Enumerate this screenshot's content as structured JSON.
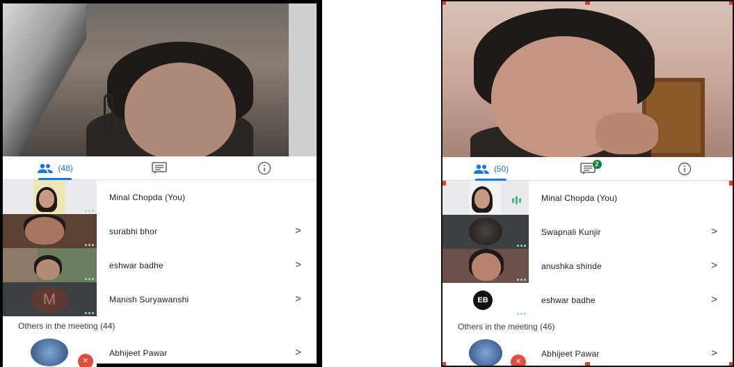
{
  "left": {
    "tabs": {
      "people_count": "(48)"
    },
    "participants": [
      {
        "name": "Minal Chopda (You)"
      },
      {
        "name": "surabhi bhor"
      },
      {
        "name": "eshwar badhe"
      },
      {
        "name": "Manish Suryawanshi",
        "initial": "M"
      }
    ],
    "others_label": "Others in the meeting (44)",
    "others": [
      {
        "name": "Abhijeet Pawar"
      }
    ]
  },
  "right": {
    "tabs": {
      "people_count": "(50)",
      "chat_badge": "2"
    },
    "participants": [
      {
        "name": "Minal Chopda (You)"
      },
      {
        "name": "Swapnali Kunjir"
      },
      {
        "name": "anushka shinde"
      },
      {
        "name": "eshwar badhe",
        "avatar_text": "EB"
      }
    ],
    "others_label": "Others in the meeting (46)",
    "others": [
      {
        "name": "Abhijeet Pawar"
      }
    ]
  },
  "chevron": ">",
  "colors": {
    "accent": "#1a73e8",
    "speaking": "#3fb68b",
    "muted": "#e04c3f",
    "selection": "#e53935"
  },
  "icons": [
    "people-icon",
    "chat-icon",
    "info-icon",
    "chevron-right-icon",
    "more-dots-icon",
    "mic-off-icon",
    "audio-bars-icon"
  ]
}
